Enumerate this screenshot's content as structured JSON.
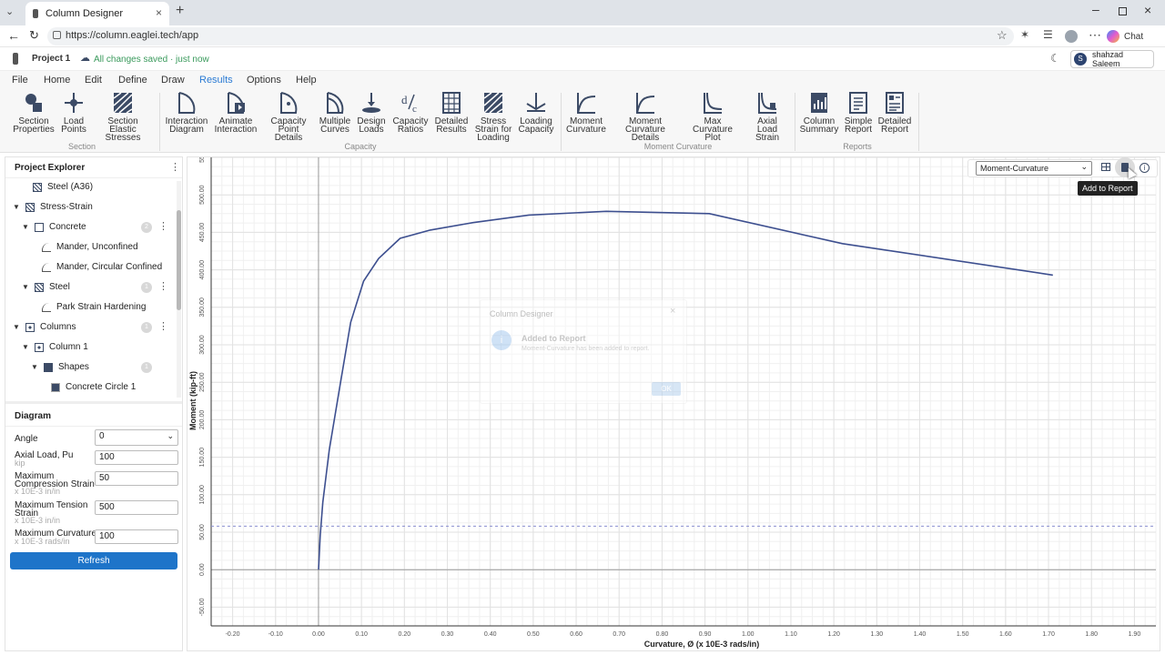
{
  "browser": {
    "tab_title": "Column Designer",
    "url": "https://column.eaglei.tech/app",
    "chat_label": "Chat"
  },
  "app": {
    "project_name": "Project 1",
    "save_status": "All changes saved · just now",
    "user_initial": "S",
    "user_name": "shahzad Saleem"
  },
  "menu": [
    "File",
    "Home",
    "Edit",
    "Define",
    "Draw",
    "Results",
    "Options",
    "Help"
  ],
  "menu_active": "Results",
  "ribbon": {
    "buttons": [
      {
        "l1": "Section",
        "l2": "Properties",
        "l3": ""
      },
      {
        "l1": "Load",
        "l2": "Points",
        "l3": ""
      },
      {
        "l1": "Section",
        "l2": "Elastic Stresses",
        "l3": ""
      },
      {
        "l1": "Interaction",
        "l2": "Diagram",
        "l3": ""
      },
      {
        "l1": "Animate",
        "l2": "Interaction",
        "l3": ""
      },
      {
        "l1": "Capacity",
        "l2": "Point Details",
        "l3": ""
      },
      {
        "l1": "Multiple",
        "l2": "Curves",
        "l3": ""
      },
      {
        "l1": "Design",
        "l2": "Loads",
        "l3": ""
      },
      {
        "l1": "Capacity",
        "l2": "Ratios",
        "l3": ""
      },
      {
        "l1": "Detailed",
        "l2": "Results",
        "l3": ""
      },
      {
        "l1": "Stress",
        "l2": "Strain for",
        "l3": "Loading"
      },
      {
        "l1": "Loading",
        "l2": "Capacity",
        "l3": ""
      },
      {
        "l1": "Moment",
        "l2": "Curvature",
        "l3": ""
      },
      {
        "l1": "Moment",
        "l2": "Curvature Details",
        "l3": ""
      },
      {
        "l1": "Max Curvature",
        "l2": "Plot",
        "l3": ""
      },
      {
        "l1": "Axial Load",
        "l2": "Strain",
        "l3": ""
      },
      {
        "l1": "Column",
        "l2": "Summary",
        "l3": ""
      },
      {
        "l1": "Simple",
        "l2": "Report",
        "l3": ""
      },
      {
        "l1": "Detailed",
        "l2": "Report",
        "l3": ""
      }
    ],
    "groups": [
      "Section",
      "Capacity",
      "Moment Curvature",
      "Reports"
    ]
  },
  "explorer": {
    "title": "Project Explorer",
    "items": [
      {
        "label": "Steel (A36)",
        "badge": ""
      },
      {
        "label": "Stress-Strain",
        "badge": ""
      },
      {
        "label": "Concrete",
        "badge": "2"
      },
      {
        "label": "Mander, Unconfined",
        "badge": ""
      },
      {
        "label": "Mander, Circular Confined",
        "badge": ""
      },
      {
        "label": "Steel",
        "badge": "1"
      },
      {
        "label": "Park Strain Hardening",
        "badge": ""
      },
      {
        "label": "Columns",
        "badge": "1"
      },
      {
        "label": "Column 1",
        "badge": ""
      },
      {
        "label": "Shapes",
        "badge": "1"
      },
      {
        "label": "Concrete Circle 1",
        "badge": ""
      }
    ]
  },
  "diagram": {
    "title": "Diagram",
    "angle_label": "Angle",
    "angle_value": "0",
    "axial_label": "Axial Load, Pu",
    "axial_unit": "kip",
    "axial_value": "100",
    "mcs_label1": "Maximum",
    "mcs_label2": "Compression Strain",
    "mcs_unit": "x 10E-3 in/in",
    "mcs_value": "50",
    "mts_label1": "Maximum Tension",
    "mts_label2": "Strain",
    "mts_unit": "x 10E-3 in/in",
    "mts_value": "500",
    "mc_label": "Maximum Curvature",
    "mc_unit": "x 10E-3 rads/in",
    "mc_value": "100",
    "refresh_label": "Refresh"
  },
  "plot_toolbar": {
    "select_value": "Moment-Curvature",
    "tooltip": "Add to Report"
  },
  "dialog": {
    "title": "Column Designer",
    "heading": "Added to Report",
    "message": "Moment-Curvature has been added to report.",
    "ok_label": "OK"
  },
  "chart_data": {
    "type": "line",
    "xlabel": "Curvature, Ø (x 10E-3 rads/in)",
    "ylabel": "Moment (kip-ft)",
    "xlim": [
      -0.25,
      1.95
    ],
    "ylim": [
      -75,
      550
    ],
    "grid": true,
    "x_ticks": [
      "-0.20",
      "-0.10",
      "0.00",
      "0.10",
      "0.20",
      "0.30",
      "0.40",
      "0.50",
      "0.60",
      "0.70",
      "0.80",
      "0.90",
      "1.00",
      "1.10",
      "1.20",
      "1.30",
      "1.40",
      "1.50",
      "1.60",
      "1.70",
      "1.80",
      "1.90"
    ],
    "y_ticks": [
      "-50.00",
      "0.00",
      "50.00",
      "100.00",
      "150.00",
      "200.00",
      "250.00",
      "300.00",
      "350.00",
      "400.00",
      "450.00",
      "500.00",
      "550"
    ],
    "reference_line_y": 58,
    "series": [
      {
        "x": [
          0.0,
          0.004,
          0.01,
          0.025,
          0.05,
          0.075,
          0.105,
          0.14,
          0.19,
          0.26,
          0.36,
          0.49,
          0.67,
          0.91,
          1.22,
          1.71
        ],
        "y": [
          0,
          45,
          90,
          160,
          245,
          330,
          385,
          415,
          442,
          453,
          463,
          473,
          478,
          475,
          435,
          393
        ]
      }
    ]
  }
}
